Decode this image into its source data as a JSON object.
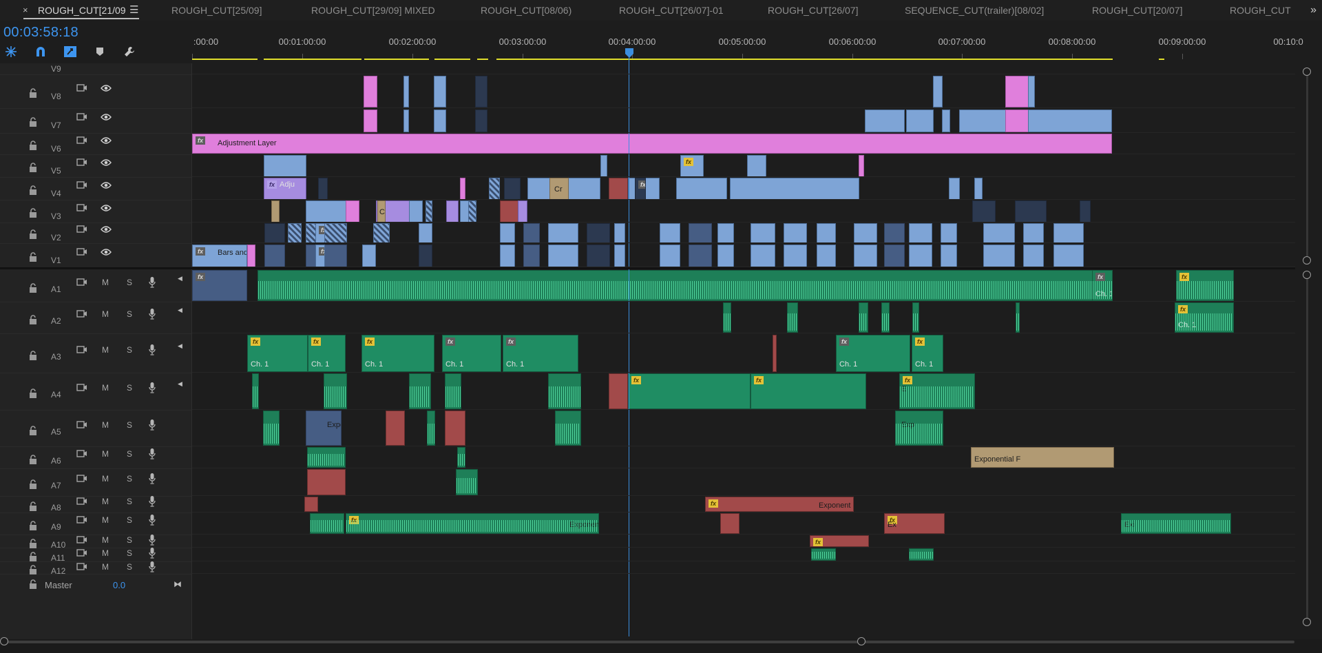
{
  "tabs": [
    {
      "label": "ROUGH_CUT[21/09",
      "active": true
    },
    {
      "label": "ROUGH_CUT[25/09]",
      "active": false
    },
    {
      "label": "ROUGH_CUT[29/09] MIXED",
      "active": false
    },
    {
      "label": "ROUGH_CUT[08/06)",
      "active": false
    },
    {
      "label": "ROUGH_CUT[26/07]-01",
      "active": false
    },
    {
      "label": "ROUGH_CUT[26/07]",
      "active": false
    },
    {
      "label": "SEQUENCE_CUT(trailer)[08/02]",
      "active": false
    },
    {
      "label": "ROUGH_CUT[20/07]",
      "active": false
    },
    {
      "label": "ROUGH_CUT",
      "active": false
    }
  ],
  "tab_close_glyph": "×",
  "tab_menu_glyph": "☰",
  "tab_overflow_glyph": "»",
  "timecode": "00:03:58:18",
  "toolbar_icons": [
    "snap-icon",
    "magnet-icon",
    "linked-selection-icon",
    "marker-icon",
    "wrench-icon"
  ],
  "ruler": {
    "labels": [
      ":00:00",
      "00:01:00:00",
      "00:02:00:00",
      "00:03:00:00",
      "00:04:00:00",
      "00:05:00:00",
      "00:06:00:00",
      "00:07:00:00",
      "00:08:00:00",
      "00:09:00:00",
      "00:10:0"
    ]
  },
  "accent_color": "#3d95f0",
  "video_tracks": [
    {
      "name": "V9"
    },
    {
      "name": "V8"
    },
    {
      "name": "V7"
    },
    {
      "name": "V6"
    },
    {
      "name": "V5"
    },
    {
      "name": "V4"
    },
    {
      "name": "V3"
    },
    {
      "name": "V2"
    },
    {
      "name": "V1"
    }
  ],
  "audio_tracks": [
    {
      "name": "A1"
    },
    {
      "name": "A2"
    },
    {
      "name": "A3"
    },
    {
      "name": "A4"
    },
    {
      "name": "A5"
    },
    {
      "name": "A6"
    },
    {
      "name": "A7"
    },
    {
      "name": "A8"
    },
    {
      "name": "A9"
    },
    {
      "name": "A10"
    },
    {
      "name": "A11"
    },
    {
      "name": "A12"
    }
  ],
  "track_buttons": {
    "mute": "M",
    "solo": "S"
  },
  "master": {
    "label": "Master",
    "value": "0.0"
  },
  "clip_texts": {
    "fx": "fx",
    "adjustment_layer": "Adjustment Layer",
    "bars_and": "Bars and",
    "adju": "Adju",
    "cr": "Cr",
    "ch1": "Ch. 1",
    "expo": "Expo",
    "exponent": "Exponent",
    "exponen": "Exponen",
    "exponential": "Exponential F",
    "expor": "Expor",
    "expon": "Expon",
    "exp": "Exp",
    "ex": "Ex",
    "exi": "Exi",
    "e": "E",
    "c": "C",
    "cl": "Cl"
  }
}
